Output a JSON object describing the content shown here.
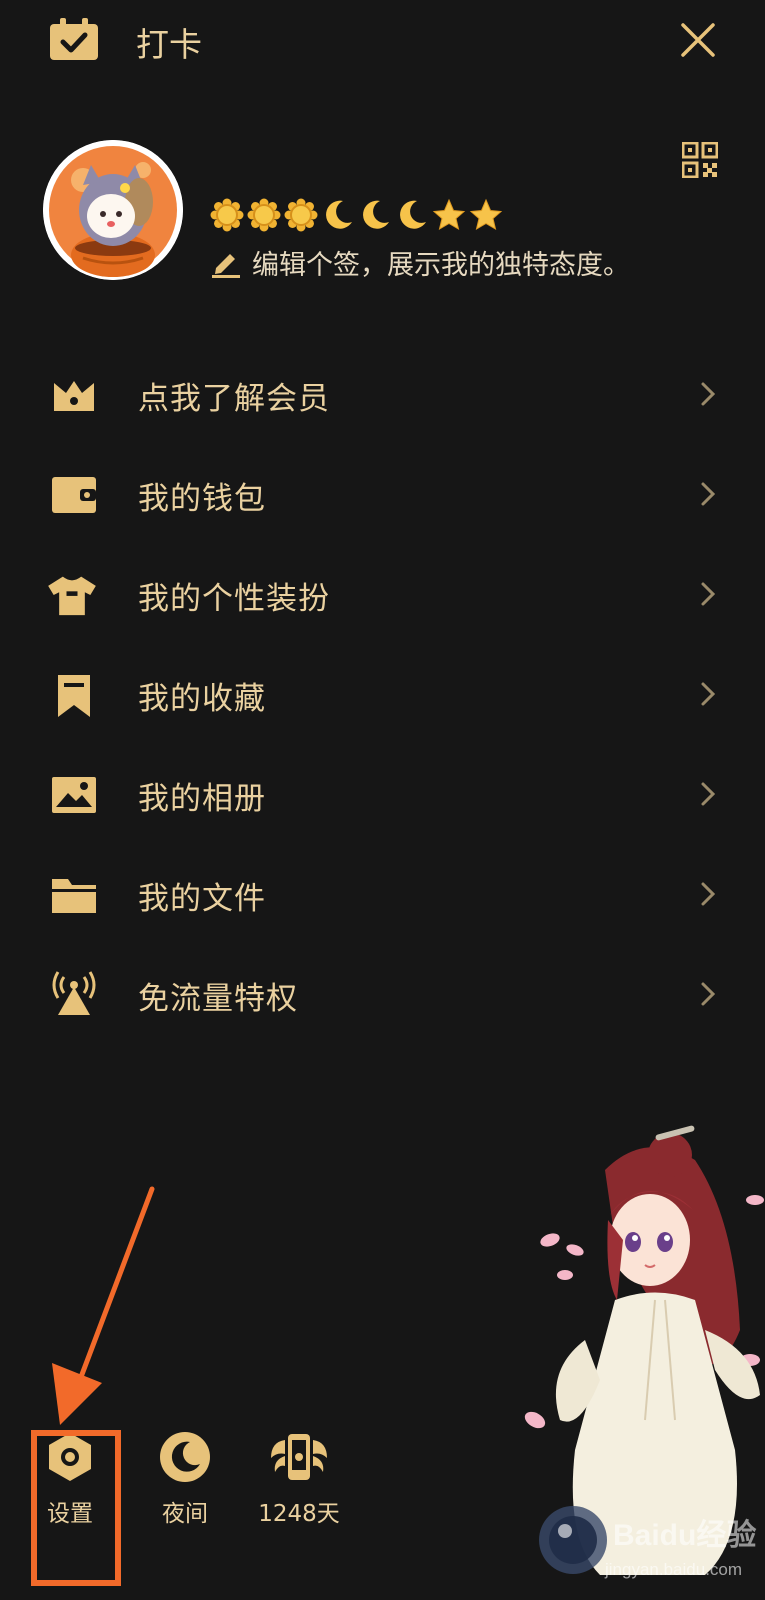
{
  "header": {
    "checkin_label": "打卡"
  },
  "profile": {
    "signature": "编辑个签，展示我的独特态度。",
    "level_badges": [
      "sun",
      "sun",
      "sun",
      "moon",
      "moon",
      "moon",
      "star",
      "star"
    ]
  },
  "menu": {
    "items": [
      {
        "label": "点我了解会员",
        "icon": "crown-icon"
      },
      {
        "label": "我的钱包",
        "icon": "wallet-icon"
      },
      {
        "label": "我的个性装扮",
        "icon": "tshirt-icon"
      },
      {
        "label": "我的收藏",
        "icon": "bookmark-icon"
      },
      {
        "label": "我的相册",
        "icon": "image-icon"
      },
      {
        "label": "我的文件",
        "icon": "folder-icon"
      },
      {
        "label": "免流量特权",
        "icon": "antenna-icon"
      }
    ]
  },
  "bottom_bar": {
    "settings_label": "设置",
    "night_label": "夜间",
    "days_label": "1248天"
  },
  "watermark": {
    "brand": "Baidu经验",
    "url": "jingyan.baidu.com"
  },
  "colors": {
    "background": "#161616",
    "accent_gold": "#e7c27a",
    "highlight_orange": "#f26a2a"
  }
}
